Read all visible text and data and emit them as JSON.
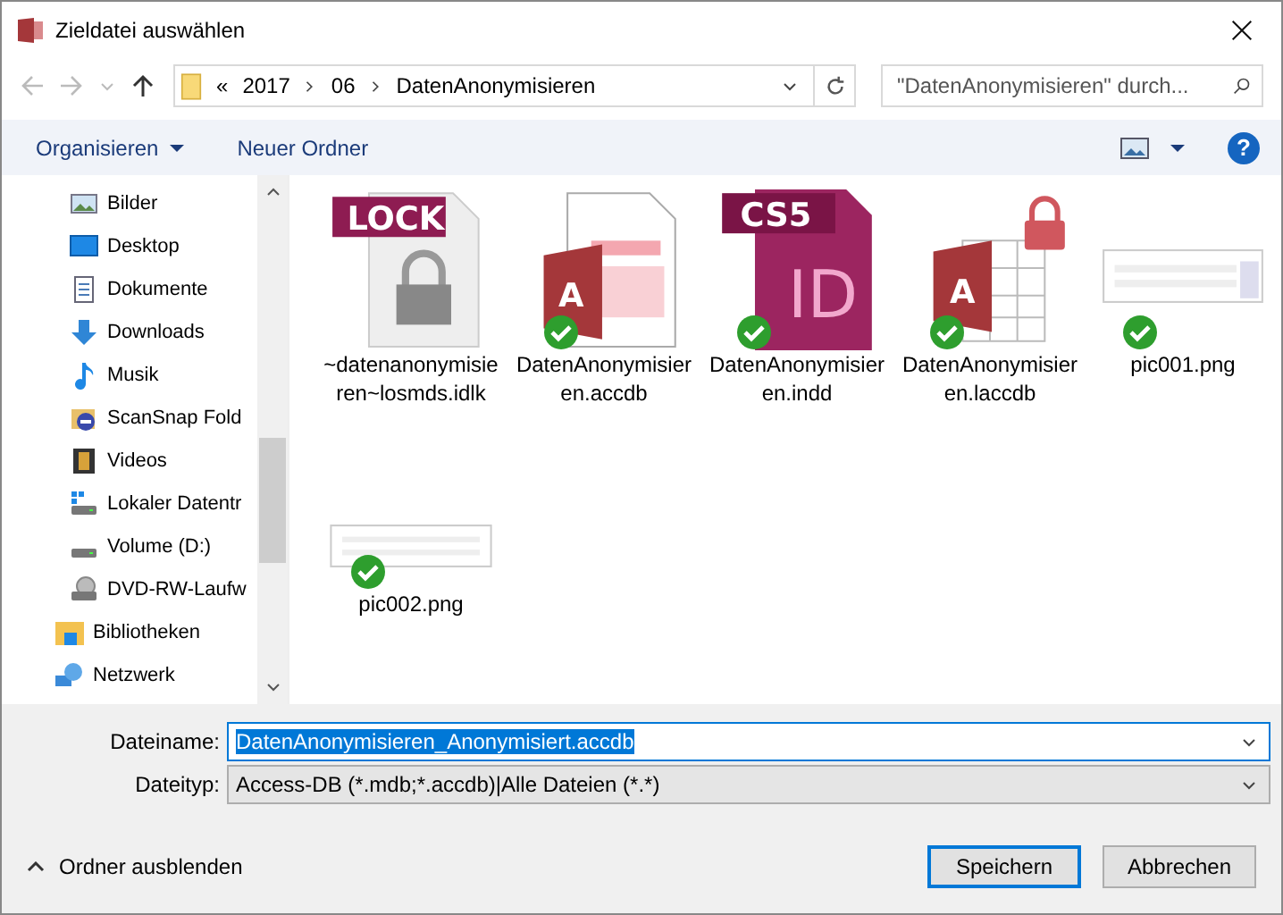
{
  "window": {
    "title": "Zieldatei auswählen"
  },
  "address": {
    "crumbs": [
      "«",
      "2017",
      "06",
      "DatenAnonymisieren"
    ]
  },
  "search": {
    "placeholder": "\"DatenAnonymisieren\" durch..."
  },
  "toolbar": {
    "buttons": [
      "Organisieren",
      "Neuer Ordner"
    ],
    "help": "?"
  },
  "sidebar": {
    "items": [
      {
        "children": [
          {
            "label": "Bilder",
            "kind": "pictures"
          },
          {
            "label": "Desktop",
            "kind": "desktop"
          },
          {
            "label": "Dokumente",
            "kind": "documents"
          },
          {
            "label": "Downloads",
            "kind": "downloads"
          },
          {
            "label": "Musik",
            "kind": "music"
          },
          {
            "label": "ScanSnap Fold",
            "kind": "scansnap"
          },
          {
            "label": "Videos",
            "kind": "videos"
          },
          {
            "label": "Lokaler Datentr",
            "kind": "drive-windows"
          },
          {
            "label": "Volume (D:)",
            "kind": "drive"
          },
          {
            "label": "DVD-RW-Laufw",
            "kind": "dvd"
          }
        ]
      },
      {
        "label": "Bibliotheken",
        "kind": "libraries"
      },
      {
        "label": "Netzwerk",
        "kind": "network"
      }
    ]
  },
  "files": [
    {
      "name": "~datenanonymisieren~losmds.idlk",
      "kind": "lock",
      "badge": "LOCK",
      "synced": false
    },
    {
      "name": "DatenAnonymisieren.accdb",
      "kind": "access",
      "glyph": "A",
      "synced": true
    },
    {
      "name": "DatenAnonymisieren.indd",
      "kind": "indesign",
      "badge": "CS5",
      "glyph": "ID",
      "synced": true
    },
    {
      "name": "DatenAnonymisieren.laccdb",
      "kind": "access-lock",
      "glyph": "A",
      "synced": true
    },
    {
      "name": "pic001.png",
      "kind": "image",
      "synced": true
    },
    {
      "name": "pic002.png",
      "kind": "image-wide",
      "synced": true
    }
  ],
  "form": {
    "filename_label": "Dateiname:",
    "filename": "DatenAnonymisieren_Anonymisiert.accdb",
    "filetype_label": "Dateityp:",
    "filetype": "Access-DB (*.mdb;*.accdb)|Alle Dateien (*.*)"
  },
  "footer": {
    "toggle": "Ordner ausblenden",
    "buttons": [
      {
        "label": "Speichern",
        "default": true
      },
      {
        "label": "Abbrechen",
        "default": false
      }
    ]
  }
}
